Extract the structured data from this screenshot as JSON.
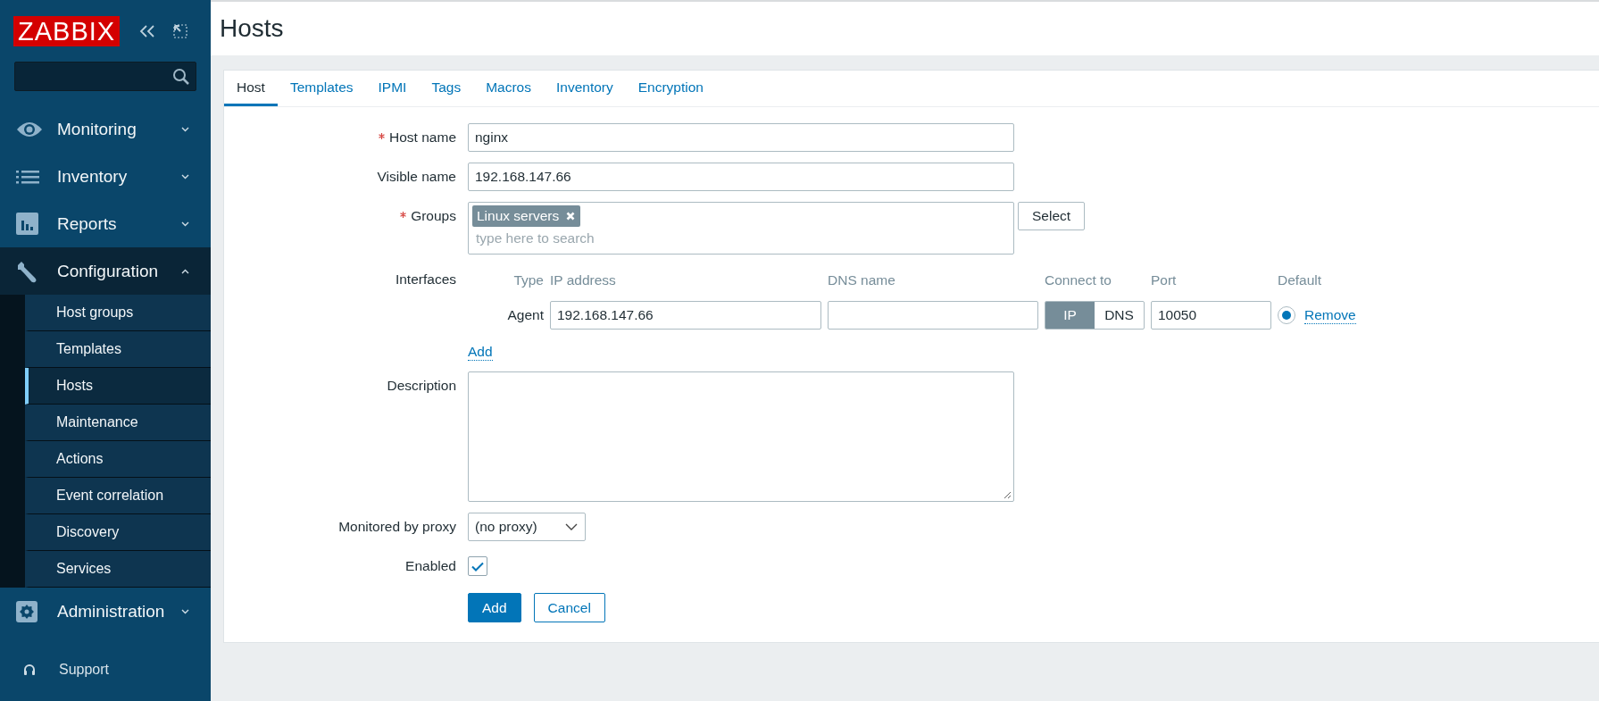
{
  "sidebar": {
    "logo": "ZABBIX",
    "menu": [
      {
        "label": "Monitoring",
        "expanded": false,
        "selected": false
      },
      {
        "label": "Inventory",
        "expanded": false,
        "selected": false
      },
      {
        "label": "Reports",
        "expanded": false,
        "selected": false
      },
      {
        "label": "Configuration",
        "expanded": true,
        "selected": true,
        "children": [
          {
            "label": "Host groups",
            "selected": false
          },
          {
            "label": "Templates",
            "selected": false
          },
          {
            "label": "Hosts",
            "selected": true
          },
          {
            "label": "Maintenance",
            "selected": false
          },
          {
            "label": "Actions",
            "selected": false
          },
          {
            "label": "Event correlation",
            "selected": false
          },
          {
            "label": "Discovery",
            "selected": false
          },
          {
            "label": "Services",
            "selected": false
          }
        ]
      },
      {
        "label": "Administration",
        "expanded": false,
        "selected": false
      }
    ],
    "support": "Support"
  },
  "page_title": "Hosts",
  "tabs": [
    {
      "label": "Host",
      "selected": true
    },
    {
      "label": "Templates",
      "selected": false
    },
    {
      "label": "IPMI",
      "selected": false
    },
    {
      "label": "Tags",
      "selected": false
    },
    {
      "label": "Macros",
      "selected": false
    },
    {
      "label": "Inventory",
      "selected": false
    },
    {
      "label": "Encryption",
      "selected": false
    }
  ],
  "form": {
    "rows": [
      {
        "kind": "text",
        "label": "Host name",
        "required": true,
        "value": "nginx"
      },
      {
        "kind": "text",
        "label": "Visible name",
        "required": false,
        "value": "192.168.147.66"
      },
      {
        "kind": "multiselect",
        "label": "Groups",
        "required": true,
        "tags": [
          "Linux servers"
        ],
        "placeholder": "type here to search",
        "button": "Select"
      },
      {
        "kind": "interfaces",
        "label": "Interfaces",
        "required": false,
        "columns": [
          "Type",
          "IP address",
          "DNS name",
          "Connect to",
          "Port",
          "Default"
        ],
        "items": [
          {
            "type": "Agent",
            "ip": "192.168.147.66",
            "connect": [
              {
                "label": "IP",
                "selected": true
              },
              {
                "label": "DNS",
                "selected": false
              }
            ],
            "port": "10050",
            "default": true,
            "remove": "Remove"
          }
        ],
        "add": "Add"
      },
      {
        "kind": "textarea",
        "label": "Description",
        "required": false
      },
      {
        "kind": "select",
        "label": "Monitored by proxy",
        "required": false,
        "value": "(no proxy)"
      },
      {
        "kind": "checkbox",
        "label": "Enabled",
        "required": false,
        "checked": true
      }
    ],
    "buttons": [
      {
        "label": "Add",
        "kind": "primary"
      },
      {
        "label": "Cancel",
        "kind": "secondary"
      }
    ]
  }
}
